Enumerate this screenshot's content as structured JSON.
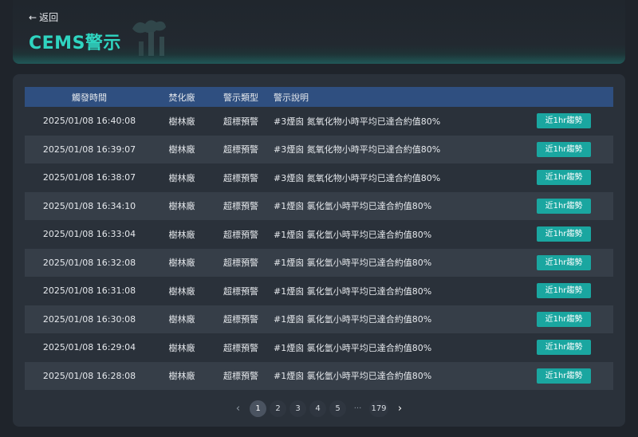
{
  "header": {
    "back_label": "返回",
    "title": "CEMS警示"
  },
  "table": {
    "columns": [
      "觸發時間",
      "焚化廠",
      "警示類型",
      "警示說明"
    ],
    "action_label": "近1hr趨勢",
    "rows": [
      {
        "time": "2025/01/08 16:40:08",
        "factory": "樹林廠",
        "type": "超標預警",
        "desc": "#3煙囪 氮氧化物小時平均已達合約值80%"
      },
      {
        "time": "2025/01/08 16:39:07",
        "factory": "樹林廠",
        "type": "超標預警",
        "desc": "#3煙囪 氮氧化物小時平均已達合約值80%"
      },
      {
        "time": "2025/01/08 16:38:07",
        "factory": "樹林廠",
        "type": "超標預警",
        "desc": "#3煙囪 氮氧化物小時平均已達合約值80%"
      },
      {
        "time": "2025/01/08 16:34:10",
        "factory": "樹林廠",
        "type": "超標預警",
        "desc": "#1煙囪 氯化氫小時平均已達合約值80%"
      },
      {
        "time": "2025/01/08 16:33:04",
        "factory": "樹林廠",
        "type": "超標預警",
        "desc": "#1煙囪 氯化氫小時平均已達合約值80%"
      },
      {
        "time": "2025/01/08 16:32:08",
        "factory": "樹林廠",
        "type": "超標預警",
        "desc": "#1煙囪 氯化氫小時平均已達合約值80%"
      },
      {
        "time": "2025/01/08 16:31:08",
        "factory": "樹林廠",
        "type": "超標預警",
        "desc": "#1煙囪 氯化氫小時平均已達合約值80%"
      },
      {
        "time": "2025/01/08 16:30:08",
        "factory": "樹林廠",
        "type": "超標預警",
        "desc": "#1煙囪 氯化氫小時平均已達合約值80%"
      },
      {
        "time": "2025/01/08 16:29:04",
        "factory": "樹林廠",
        "type": "超標預警",
        "desc": "#1煙囪 氯化氫小時平均已達合約值80%"
      },
      {
        "time": "2025/01/08 16:28:08",
        "factory": "樹林廠",
        "type": "超標預警",
        "desc": "#1煙囪 氯化氫小時平均已達合約值80%"
      }
    ]
  },
  "pagination": {
    "pages": [
      "1",
      "2",
      "3",
      "4",
      "5"
    ],
    "ellipsis": "···",
    "last_page": "179",
    "current": "1"
  },
  "colors": {
    "accent": "#2fd4c0",
    "button": "#1aa6a0",
    "table_header": "#2f4f80"
  }
}
